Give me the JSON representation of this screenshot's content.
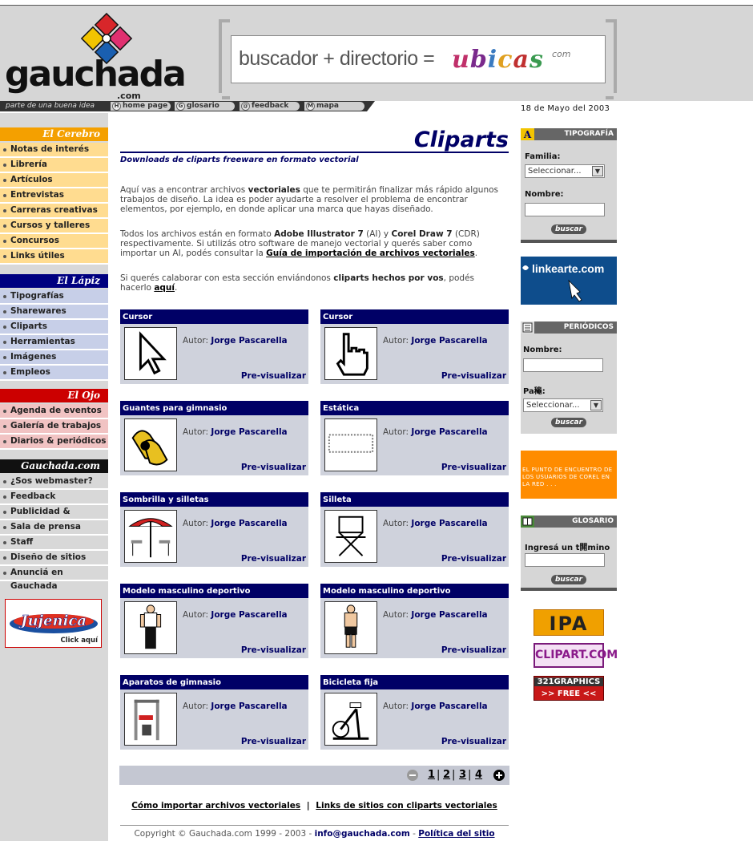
{
  "header": {
    "logo_text": "gauchada",
    "logo_com": ".com",
    "banner_text": "buscador + directorio =",
    "banner_brand_letters": [
      "u",
      "b",
      "i",
      "c",
      "a",
      "s"
    ],
    "banner_brand_colors": [
      "#c0306a",
      "#7a2a8c",
      "#3a7ac0",
      "#e0a020",
      "#c03030",
      "#3a9a50"
    ],
    "banner_com": "com"
  },
  "navbar": {
    "motto": "parte de una buena idea",
    "items": [
      {
        "label": "home page",
        "icon": "H"
      },
      {
        "label": "glosario",
        "icon": "G"
      },
      {
        "label": "feedback",
        "icon": "@"
      },
      {
        "label": "mapa",
        "icon": "M"
      }
    ],
    "date": "18 de Mayo del 2003"
  },
  "sidebar": {
    "sections": [
      {
        "title": "El Cerebro",
        "head_color": "#f4a000",
        "item_color": "#ffdc90",
        "items": [
          "Notas de interés",
          "Librería",
          "Artículos",
          "Entrevistas",
          "Carreras creativas",
          "Cursos y talleres",
          "Concursos",
          "Links útiles"
        ]
      },
      {
        "title": "El Lápiz",
        "head_color": "#000080",
        "item_color": "#c7cfe8",
        "items": [
          "Tipografías",
          "Sharewares",
          "Cliparts",
          "Herramientas",
          "Imágenes",
          "Empleos"
        ]
      },
      {
        "title": "El Ojo",
        "head_color": "#cc0000",
        "item_color": "#f1c3c3",
        "items": [
          "Agenda de eventos",
          "Galería de trabajos",
          "Diarios & periódicos"
        ]
      },
      {
        "title": "Gauchada.com",
        "head_color": "#111111",
        "item_color": "#d8d8d8",
        "items": [
          "¿Sos webmaster?",
          "Feedback",
          "Publicidad & difusión",
          "Sala de prensa",
          "Staff",
          "Diseño de sitios web",
          "Anunciá en Gauchada"
        ]
      }
    ],
    "ad_label": "Click aquí",
    "ad_brand": "Jujenica"
  },
  "main": {
    "title": "Cliparts",
    "subtitle": "Downloads de cliparts freeware en formato vectorial",
    "p1_a": "Aquí vas a encontrar archivos ",
    "p1_b": "vectoriales",
    "p1_c": " que te permitirán finalizar más rápido algunos trabajos de diseño. La idea es poder ayudarte a resolver el problema de encontrar elementos, por ejemplo, en donde aplicar una marca que hayas diseñado.",
    "p2_a": "Todos los archivos están en formato ",
    "p2_b": "Adobe Illustrator 7",
    "p2_c": " (AI) y ",
    "p2_d": "Corel Draw 7",
    "p2_e": " (CDR) respectivamente. Si utilizás otro software de manejo vectorial y querés saber como importar un AI, podés consultar la ",
    "p2_link": "Guía de importación de archivos vectoriales",
    "p2_f": ".",
    "p3_a": "Si querés calaborar con esta sección enviándonos ",
    "p3_b": "cliparts hechos por vos",
    "p3_c": ", podés hacerlo ",
    "p3_link": "aquí",
    "p3_d": ".",
    "author_label": "Autor:",
    "preview_label": "Pre-visualizar",
    "cards": [
      {
        "title": "Cursor",
        "author": "Jorge Pascarella",
        "thumb": "arrow"
      },
      {
        "title": "Cursor",
        "author": "Jorge Pascarella",
        "thumb": "hand"
      },
      {
        "title": "Guantes para gimnasio",
        "author": "Jorge Pascarella",
        "thumb": "gloves"
      },
      {
        "title": "Estática",
        "author": "Jorge Pascarella",
        "thumb": "static"
      },
      {
        "title": "Sombrilla y silletas",
        "author": "Jorge Pascarella",
        "thumb": "umbrella"
      },
      {
        "title": "Silleta",
        "author": "Jorge Pascarella",
        "thumb": "chair"
      },
      {
        "title": "Modelo masculino deportivo",
        "author": "Jorge Pascarella",
        "thumb": "man1"
      },
      {
        "title": "Modelo masculino deportivo",
        "author": "Jorge Pascarella",
        "thumb": "man2"
      },
      {
        "title": "Aparatos de gimnasio",
        "author": "Jorge Pascarella",
        "thumb": "gym"
      },
      {
        "title": "Bicicleta fija",
        "author": "Jorge Pascarella",
        "thumb": "bike"
      }
    ],
    "pages": [
      "1",
      "2",
      "3",
      "4"
    ],
    "footer_link1": "Cómo importar archivos vectoriales",
    "footer_sep": "|",
    "footer_link2": "Links de sitios con cliparts vectoriales",
    "copyright": "Copyright © Gauchada.com 1999 - 2003 - ",
    "email": "info@gauchada.com",
    "dash": " - ",
    "policy": "Política del sitio"
  },
  "right": {
    "tipografia": {
      "title": "TIPOGRAFÍA",
      "familia_label": "Familia:",
      "select_value": "Seleccionar...",
      "nombre_label": "Nombre:",
      "button": "buscar"
    },
    "linkearte": "linkearte.com",
    "periodicos": {
      "title": "PERIÓDICOS",
      "nombre_label": "Nombre:",
      "pais_label": "Pa龝:",
      "select_value": "Seleccionar...",
      "button": "buscar"
    },
    "corel_text": "EL PUNTO DE ENCUENTRO DE LOS USUARIOS DE COREL EN LA RED . . .",
    "glosario": {
      "title": "GLOSARIO",
      "label": "Ingresá un t閞mino",
      "button": "buscar"
    },
    "ads": [
      "IPA",
      "CLIPART.COM",
      "321GRAPHICS",
      ">> FREE <<"
    ]
  }
}
